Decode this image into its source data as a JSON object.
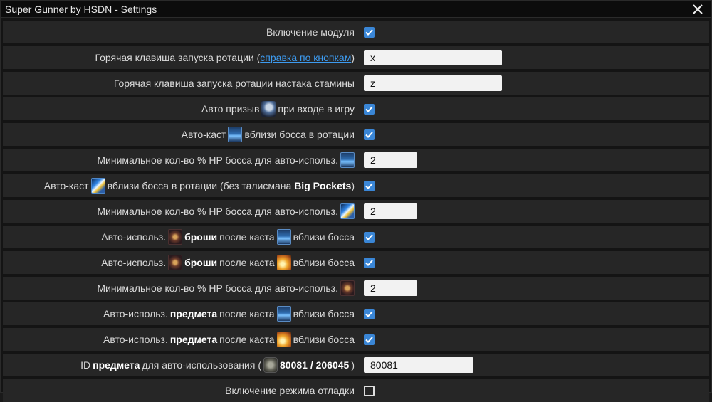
{
  "window": {
    "title": "Super Gunner by HSDN - Settings"
  },
  "rows": [
    {
      "label": "Включение модуля",
      "checked": true
    },
    {
      "label_before": "Горячая клавиша запуска ротации (",
      "link": "справка по кнопкам",
      "label_after": ")",
      "value": "x"
    },
    {
      "label": "Горячая клавиша запуска ротации настака стамины",
      "value": "z"
    },
    {
      "label_before": "Авто призыв",
      "label_after": "при входе в игру",
      "icon": "summon-icon",
      "checked": true
    },
    {
      "label_before": "Авто-каст",
      "label_after": "вблизи босса в ротации",
      "icon": "wave-skill-icon",
      "checked": true
    },
    {
      "label": "Минимальное кол-во % HP босса для авто-использ.",
      "icon": "wave-skill-icon",
      "value": "2"
    },
    {
      "label_before": "Авто-каст",
      "label_mid": "вблизи босса в ротации (без талисмана",
      "label_bold": "Big Pockets",
      "label_after": ")",
      "icon": "beam-skill-icon",
      "checked": true
    },
    {
      "label": "Минимальное кол-во % HP босса для авто-использ.",
      "icon": "beam-skill-icon",
      "value": "2"
    },
    {
      "label_before": "Авто-использ.",
      "label_bold": "броши",
      "label_mid": "после каста",
      "label_after": "вблизи босса",
      "icon1": "brooch-icon",
      "icon2": "wave-skill-icon",
      "checked": true
    },
    {
      "label_before": "Авто-использ.",
      "label_bold": "броши",
      "label_mid": "после каста",
      "label_after": "вблизи босса",
      "icon1": "brooch-icon",
      "icon2": "blast-skill-icon",
      "checked": true
    },
    {
      "label": "Минимальное кол-во % HP босса для авто-использ.",
      "icon": "brooch-icon",
      "value": "2"
    },
    {
      "label_before": "Авто-использ.",
      "label_bold": "предмета",
      "label_mid": "после каста",
      "label_after": "вблизи босса",
      "icon": "wave-skill-icon",
      "checked": true
    },
    {
      "label_before": "Авто-использ.",
      "label_bold": "предмета",
      "label_mid": "после каста",
      "label_after": "вблизи босса",
      "icon": "blast-skill-icon",
      "checked": true
    },
    {
      "label_before": "ID",
      "label_bold": "предмета",
      "label_mid": "для авто-использования (",
      "icon": "item-icon",
      "label_ids": "80081 / 206045",
      "label_after": ")",
      "value": "80081"
    },
    {
      "label": "Включение режима отладки",
      "checked": false
    }
  ],
  "colors": {
    "accent": "#3a86d6",
    "link": "#3d9bf0",
    "row_bg": "#262626",
    "window_bg": "#141414"
  }
}
